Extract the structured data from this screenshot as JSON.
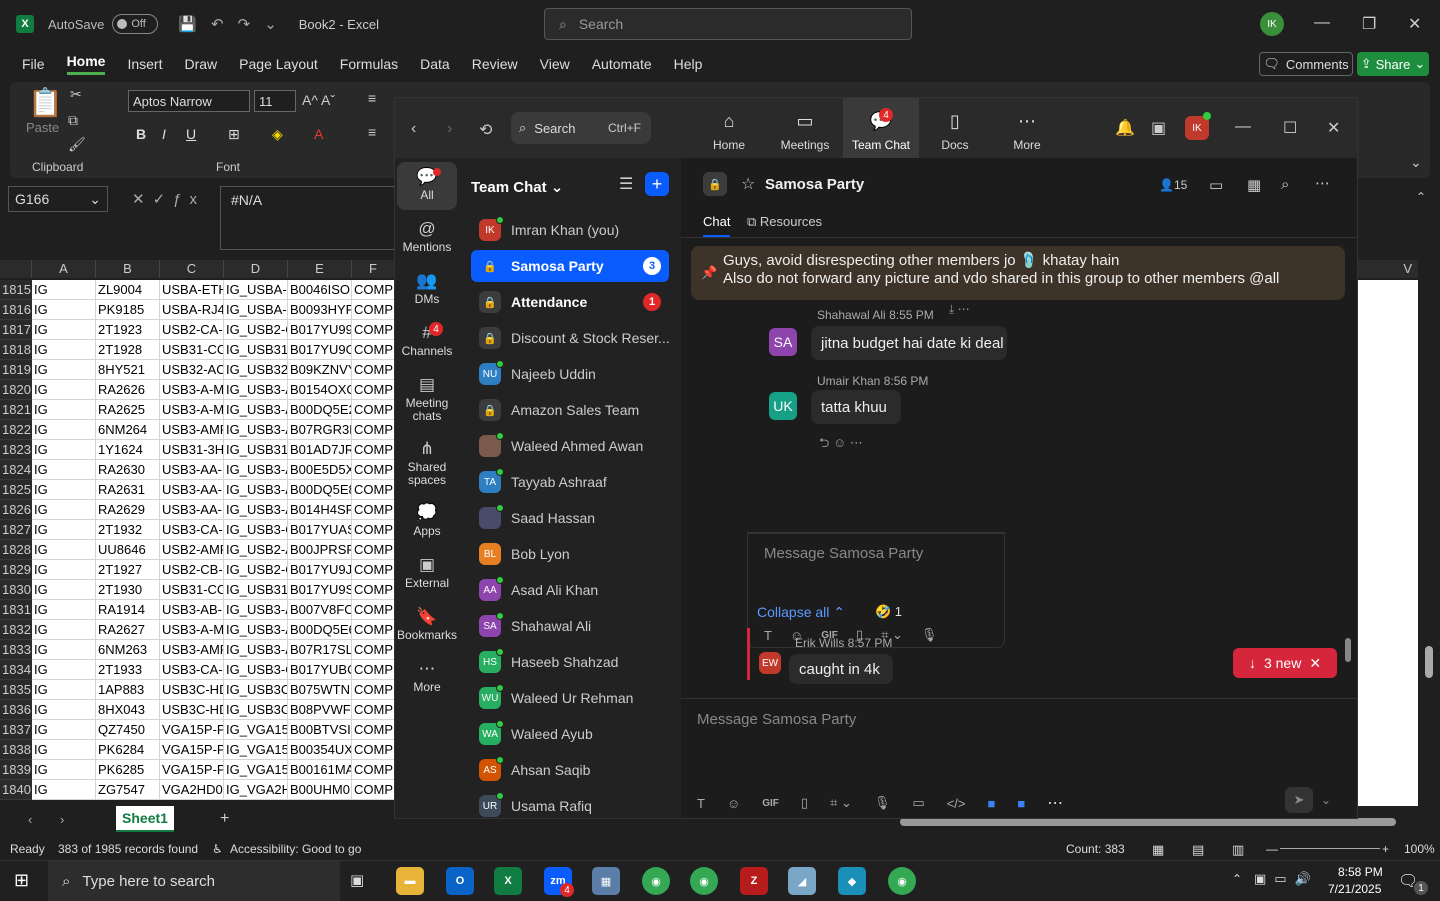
{
  "excel": {
    "app_title": "Book2 - Excel",
    "autosave_label": "AutoSave",
    "autosave_state": "Off",
    "search_placeholder": "Search",
    "user_initials": "IK",
    "menu": [
      "File",
      "Home",
      "Insert",
      "Draw",
      "Page Layout",
      "Formulas",
      "Data",
      "Review",
      "View",
      "Automate",
      "Help"
    ],
    "comments_label": "Comments",
    "share_label": "Share",
    "ribbon": {
      "paste_label": "Paste",
      "clipboard_label": "Clipboard",
      "font_label": "Font",
      "font_name": "Aptos Narrow",
      "font_size": "11"
    },
    "name_box": "G166",
    "formula_value": "#N/A",
    "columns": [
      "A",
      "B",
      "C",
      "D",
      "E",
      "F"
    ],
    "right_column": "V",
    "rows": [
      {
        "n": "1815",
        "a": "IG",
        "b": "ZL9004",
        "c": "USBA-ETH",
        "d": "IG_USBA-E",
        "e": "B0046ISO",
        "f": "COMP"
      },
      {
        "n": "1816",
        "a": "IG",
        "b": "PK9185",
        "c": "USBA-RJ45",
        "d": "IG_USBA-F",
        "e": "B0093HYP",
        "f": "COMP"
      },
      {
        "n": "1817",
        "a": "IG",
        "b": "2T1923",
        "c": "USB2-CA-3",
        "d": "IG_USB2-C",
        "e": "B017YU99",
        "f": "COMP"
      },
      {
        "n": "1818",
        "a": "IG",
        "b": "2T1928",
        "c": "USB31-CC-",
        "d": "IG_USB31-",
        "e": "B017YU9G",
        "f": "COMP"
      },
      {
        "n": "1819",
        "a": "IG",
        "b": "8HY521",
        "c": "USB32-AC-",
        "d": "IG_USB32-",
        "e": "B09KZNVY",
        "f": "COMP"
      },
      {
        "n": "1820",
        "a": "IG",
        "b": "RA2626",
        "c": "USB3-A-M",
        "d": "IG_USB3-A",
        "e": "B0154OXC",
        "f": "COMP"
      },
      {
        "n": "1821",
        "a": "IG",
        "b": "RA2625",
        "c": "USB3-A-M",
        "d": "IG_USB3-A",
        "e": "B00DQ5E2",
        "f": "COMP"
      },
      {
        "n": "1822",
        "a": "IG",
        "b": "6NM264",
        "c": "USB3-AMF",
        "d": "IG_USB3-A",
        "e": "B07RGR3R",
        "f": "COMP"
      },
      {
        "n": "1823",
        "a": "IG",
        "b": "1Y1624",
        "c": "USB31-3HI",
        "d": "IG_USB31-",
        "e": "B01AD7JR",
        "f": "COMP"
      },
      {
        "n": "1824",
        "a": "IG",
        "b": "RA2630",
        "c": "USB3-AA-I",
        "d": "IG_USB3-A",
        "e": "B00E5D5X",
        "f": "COMP"
      },
      {
        "n": "1825",
        "a": "IG",
        "b": "RA2631",
        "c": "USB3-AA-I",
        "d": "IG_USB3-A",
        "e": "B00DQ5E8",
        "f": "COMP"
      },
      {
        "n": "1826",
        "a": "IG",
        "b": "RA2629",
        "c": "USB3-AA-I",
        "d": "IG_USB3-A",
        "e": "B014H4SR",
        "f": "COMP"
      },
      {
        "n": "1827",
        "a": "IG",
        "b": "2T1932",
        "c": "USB3-CA-3",
        "d": "IG_USB3-C",
        "e": "B017YUAS",
        "f": "COMP"
      },
      {
        "n": "1828",
        "a": "IG",
        "b": "UU8646",
        "c": "USB2-AMF",
        "d": "IG_USB2-A",
        "e": "B00JPRSP",
        "f": "COMP"
      },
      {
        "n": "1829",
        "a": "IG",
        "b": "2T1927",
        "c": "USB2-CB-6",
        "d": "IG_USB2-C",
        "e": "B017YU9J",
        "f": "COMP"
      },
      {
        "n": "1830",
        "a": "IG",
        "b": "2T1930",
        "c": "USB31-CC-",
        "d": "IG_USB31-",
        "e": "B017YU9S",
        "f": "COMP"
      },
      {
        "n": "1831",
        "a": "IG",
        "b": "RA1914",
        "c": "USB3-AB-1",
        "d": "IG_USB3-A",
        "e": "B007V8FC",
        "f": "COMP"
      },
      {
        "n": "1832",
        "a": "IG",
        "b": "RA2627",
        "c": "USB3-A-M",
        "d": "IG_USB3-A",
        "e": "B00DQ5E6",
        "f": "COMP"
      },
      {
        "n": "1833",
        "a": "IG",
        "b": "6NM263",
        "c": "USB3-AMF",
        "d": "IG_USB3-A",
        "e": "B07R17SL",
        "f": "COMP"
      },
      {
        "n": "1834",
        "a": "IG",
        "b": "2T1933",
        "c": "USB3-CA-6",
        "d": "IG_USB3-C",
        "e": "B017YUBC",
        "f": "COMP"
      },
      {
        "n": "1835",
        "a": "IG",
        "b": "1AP883",
        "c": "USB3C-HD",
        "d": "IG_USB3C-",
        "e": "B075WTN",
        "f": "COMP"
      },
      {
        "n": "1836",
        "a": "IG",
        "b": "8HX043",
        "c": "USB3C-HD",
        "d": "IG_USB3C-",
        "e": "B08PVWFJ",
        "f": "COMP"
      },
      {
        "n": "1837",
        "a": "IG",
        "b": "QZ7450",
        "c": "VGA15P-P",
        "d": "IG_VGA15I",
        "e": "B00BTVSI7",
        "f": "COMP"
      },
      {
        "n": "1838",
        "a": "IG",
        "b": "PK6284",
        "c": "VGA15P-P",
        "d": "IG_VGA15I",
        "e": "B00354UX",
        "f": "COMP"
      },
      {
        "n": "1839",
        "a": "IG",
        "b": "PK6285",
        "c": "VGA15P-P",
        "d": "IG_VGA15I",
        "e": "B00161MA",
        "f": "COMP"
      },
      {
        "n": "1840",
        "a": "IG",
        "b": "ZG7547",
        "c": "VGA2HD01",
        "d": "IG_VGA2H",
        "e": "B00UHM0",
        "f": "COMP"
      }
    ],
    "sheet_tab": "Sheet1",
    "status": {
      "ready": "Ready",
      "records": "383 of 1985 records found",
      "accessibility": "Accessibility: Good to go",
      "count": "Count: 383",
      "zoom": "100%"
    }
  },
  "zoom": {
    "search_label": "Search",
    "search_shortcut": "Ctrl+F",
    "tabs": [
      {
        "label": "Home",
        "icon": "home-icon"
      },
      {
        "label": "Meetings",
        "icon": "video-icon"
      },
      {
        "label": "Team Chat",
        "icon": "chat-icon",
        "badge": "4"
      },
      {
        "label": "Docs",
        "icon": "doc-icon"
      },
      {
        "label": "More",
        "icon": "more-icon"
      }
    ],
    "user_initials": "IK",
    "rail": [
      {
        "label": "All"
      },
      {
        "label": "Mentions"
      },
      {
        "label": "DMs"
      },
      {
        "label": "Channels",
        "badge": "4"
      },
      {
        "label": "Meeting chats"
      },
      {
        "label": "Shared spaces"
      },
      {
        "label": "Apps"
      },
      {
        "label": "External"
      },
      {
        "label": "Bookmarks"
      },
      {
        "label": "More"
      }
    ],
    "list_title": "Team Chat",
    "list": [
      {
        "name": "Imran Khan (you)",
        "initials": "IK",
        "color": "#c0392b",
        "online": true
      },
      {
        "name": "Samosa Party",
        "lock": true,
        "count": "3",
        "selected": true
      },
      {
        "name": "Attendance",
        "lock": true,
        "count": "1",
        "bold": true
      },
      {
        "name": "Discount & Stock Reser...",
        "lock": true
      },
      {
        "name": "Najeeb Uddin",
        "initials": "NU",
        "color": "#2d7fc1",
        "online": true
      },
      {
        "name": "Amazon Sales Team",
        "lock": true
      },
      {
        "name": "Waleed Ahmed Awan",
        "initials": "",
        "color": "#7a5a4a",
        "online": true
      },
      {
        "name": "Tayyab Ashraaf",
        "initials": "TA",
        "color": "#2d7fc1",
        "online": true
      },
      {
        "name": "Saad Hassan",
        "initials": "",
        "color": "#4a4a6a",
        "online": true
      },
      {
        "name": "Bob Lyon",
        "initials": "BL",
        "color": "#e67e22"
      },
      {
        "name": "Asad Ali Khan",
        "initials": "AA",
        "color": "#8e44ad",
        "online": true
      },
      {
        "name": "Shahawal Ali",
        "initials": "SA",
        "color": "#8e44ad",
        "online": true
      },
      {
        "name": "Haseeb Shahzad",
        "initials": "HS",
        "color": "#27ae60",
        "online": true
      },
      {
        "name": "Waleed Ur Rehman",
        "initials": "WU",
        "color": "#27ae60",
        "online": true
      },
      {
        "name": "Waleed Ayub",
        "initials": "WA",
        "color": "#27ae60",
        "online": true
      },
      {
        "name": "Ahsan Saqib",
        "initials": "AS",
        "color": "#d35400",
        "online": true
      },
      {
        "name": "Usama Rafiq",
        "initials": "UR",
        "color": "#3c4a5a",
        "online": true
      }
    ],
    "chat": {
      "title": "Samosa Party",
      "members": "15",
      "tab_chat": "Chat",
      "tab_resources": "Resources",
      "pinned_line1": "Guys, avoid disrespecting other members jo 🩴 khatay hain",
      "pinned_line2": "Also do not forward any picture and vdo shared in this group to other members @all",
      "messages": [
        {
          "name": "Shahawal Ali",
          "time": "8:55 PM",
          "text": "jitna budget hai date ki deal",
          "initials": "SA",
          "color": "#8e44ad"
        },
        {
          "name": "Umair Khan",
          "time": "8:56 PM",
          "text": "tatta khuu",
          "initials": "UK",
          "color": "#16a085"
        }
      ],
      "thread_placeholder": "Message Samosa Party",
      "collapse_label": "Collapse all",
      "reaction": "🤣 1",
      "last_message": {
        "name": "Erik Wills",
        "time": "8:57 PM",
        "text": "caught in 4k",
        "initials": "EW",
        "color": "#c0392b"
      },
      "new_pill": "3 new",
      "composer_placeholder": "Message Samosa Party"
    }
  },
  "taskbar": {
    "search_placeholder": "Type here to search",
    "time": "8:58 PM",
    "date": "7/21/2025",
    "zoom_badge": "4",
    "notif_badge": "1"
  }
}
